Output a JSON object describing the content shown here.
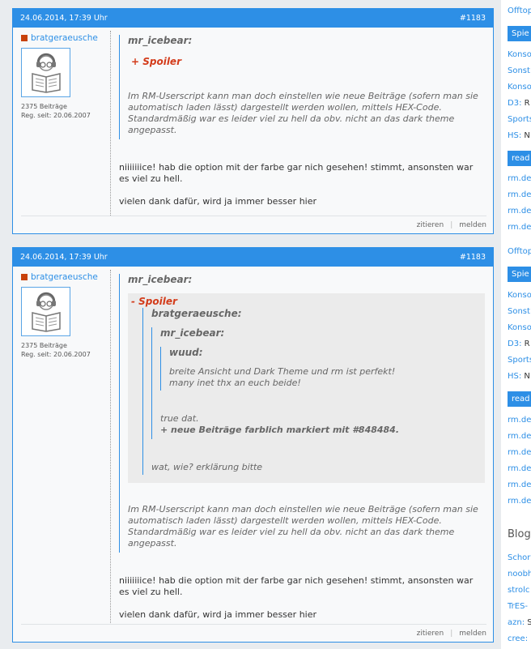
{
  "posts": [
    {
      "date": "24.06.2014, 17:39 Uhr",
      "number": "#1183",
      "user": {
        "name": "bratgeraeusche",
        "posts": "2375 Beiträge",
        "reg": "Reg. seit: 20.06.2007"
      },
      "quote_author": "mr_icebear:",
      "spoiler_label": "+ Spoiler",
      "quote_text": "Im RM-Userscript kann man doch einstellen wie neue Beiträge (sofern man sie automatisch laden lässt) dargestellt werden wollen, mittels HEX-Code. Standardmäßig war es leider viel zu hell da obv. nicht an das dark theme angepasst.",
      "reply": "niiiiiiice! hab die option mit der farbe gar nich gesehen! stimmt, ansonsten war es viel zu hell.",
      "reply2": "vielen dank dafür, wird ja immer besser hier",
      "actions": {
        "quote": "zitieren",
        "report": "melden"
      }
    },
    {
      "date": "24.06.2014, 17:39 Uhr",
      "number": "#1183",
      "user": {
        "name": "bratgeraeusche",
        "posts": "2375 Beiträge",
        "reg": "Reg. seit: 20.06.2007"
      },
      "quote_author": "mr_icebear:",
      "spoiler_label": "- Spoiler",
      "nested1_author": "bratgeraeusche:",
      "nested2_author": "mr_icebear:",
      "nested3_author": "wuud:",
      "nested3_text": "breite Ansicht und Dark Theme und rm ist perfekt! many inet thx an euch beide!",
      "nested2_text1": "true dat.",
      "nested2_text2": "+ neue Beiträge farblich markiert mit #848484.",
      "nested1_text": "wat, wie? erklärung bitte",
      "quote_text": "Im RM-Userscript kann man doch einstellen wie neue Beiträge (sofern man sie automatisch laden lässt) dargestellt werden wollen, mittels HEX-Code. Standardmäßig war es leider viel zu hell da obv. nicht an das dark theme angepasst.",
      "reply": "niiiiiiice! hab die option mit der farbe gar nich gesehen! stimmt, ansonsten war es viel zu hell.",
      "reply2": "vielen dank dafür, wird ja immer besser hier",
      "actions": {
        "quote": "zitieren",
        "report": "melden"
      }
    }
  ],
  "sidebar": {
    "items": [
      {
        "t": "Offtop",
        "kind": "link"
      },
      {
        "t": "Spie",
        "kind": "head"
      },
      {
        "t": "Konso",
        "kind": "link"
      },
      {
        "t": "Sonst",
        "kind": "link"
      },
      {
        "t": "Konso",
        "kind": "link"
      },
      {
        "pre": "D3:",
        "t": " R",
        "kind": "mixed"
      },
      {
        "t": "Sports",
        "kind": "link"
      },
      {
        "pre": "HS:",
        "t": " N",
        "kind": "mixed"
      },
      {
        "t": "read",
        "kind": "head"
      },
      {
        "t": "rm.de",
        "kind": "link"
      },
      {
        "t": "rm.de",
        "kind": "link"
      },
      {
        "t": "rm.de",
        "kind": "link"
      },
      {
        "t": "rm.de",
        "kind": "link"
      },
      {
        "t": "Offtop",
        "kind": "link"
      },
      {
        "t": "Spie",
        "kind": "head"
      },
      {
        "t": "Konso",
        "kind": "link"
      },
      {
        "t": "Sonst",
        "kind": "link"
      },
      {
        "t": "Konso",
        "kind": "link"
      },
      {
        "pre": "D3:",
        "t": " R",
        "kind": "mixed"
      },
      {
        "t": "Sports",
        "kind": "link"
      },
      {
        "pre": "HS:",
        "t": " N",
        "kind": "mixed"
      },
      {
        "t": "read",
        "kind": "head"
      },
      {
        "t": "rm.de",
        "kind": "link"
      },
      {
        "t": "rm.de",
        "kind": "link"
      },
      {
        "t": "rm.de",
        "kind": "link"
      },
      {
        "t": "rm.de",
        "kind": "link"
      },
      {
        "t": "rm.de",
        "kind": "link"
      },
      {
        "t": "rm.de",
        "kind": "link"
      },
      {
        "t": "Blog-",
        "kind": "title"
      },
      {
        "t": "Schor",
        "kind": "link"
      },
      {
        "t": "noobh",
        "kind": "link"
      },
      {
        "t": "strolc",
        "kind": "link"
      },
      {
        "t": "TrES-",
        "kind": "link"
      },
      {
        "pre": "azn:",
        "t": " S",
        "kind": "mixed"
      },
      {
        "pre": "cree:",
        "t": "",
        "kind": "mixed"
      }
    ]
  },
  "colors": {
    "accent": "#2d8fe6",
    "spoiler": "#d33b1a",
    "user_square": "#c8410b"
  }
}
